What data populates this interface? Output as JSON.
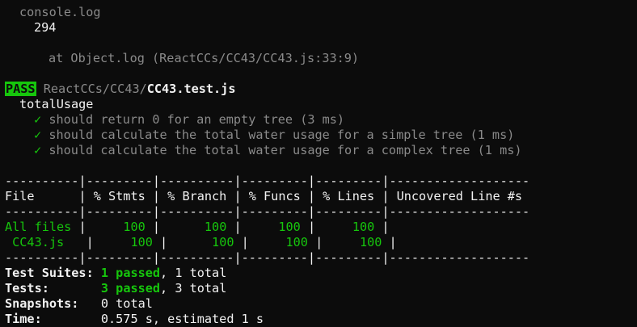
{
  "console": {
    "header": "console.log",
    "value": "294",
    "location": "at Object.log (ReactCCs/CC43/CC43.js:33:9)"
  },
  "result": {
    "badge": "PASS",
    "path_dir": "ReactCCs/CC43/",
    "path_file": "CC43.test.js",
    "suite": "totalUsage",
    "check_mark": "✓",
    "tests": [
      "should return 0 for an empty tree (3 ms)",
      "should calculate the total water usage for a simple tree (1 ms)",
      "should calculate the total water usage for a complex tree (1 ms)"
    ]
  },
  "coverage": {
    "separator": "----------|---------|----------|---------|---------|-------------------",
    "header": "File      | % Stmts | % Branch | % Funcs | % Lines | Uncovered Line #s",
    "rows": [
      {
        "file": "All files",
        "stmts": "100",
        "branch": "100",
        "funcs": "100",
        "lines": "100",
        "uncovered": ""
      },
      {
        "file": " CC43.js",
        "stmts": "100",
        "branch": "100",
        "funcs": "100",
        "lines": "100",
        "uncovered": ""
      }
    ]
  },
  "summary": {
    "suites_label": "Test Suites:",
    "suites_passed": "1 passed",
    "suites_total": ", 1 total",
    "tests_label": "Tests:",
    "tests_passed": "3 passed",
    "tests_total": ", 3 total",
    "snapshots_label": "Snapshots:",
    "snapshots_value": "0 total",
    "time_label": "Time:",
    "time_value": "0.575 s, estimated 1 s"
  },
  "colors": {
    "background": "#0c0c0c",
    "text": "#cccccc",
    "dim": "#8a8a8a",
    "green": "#16c60c"
  }
}
